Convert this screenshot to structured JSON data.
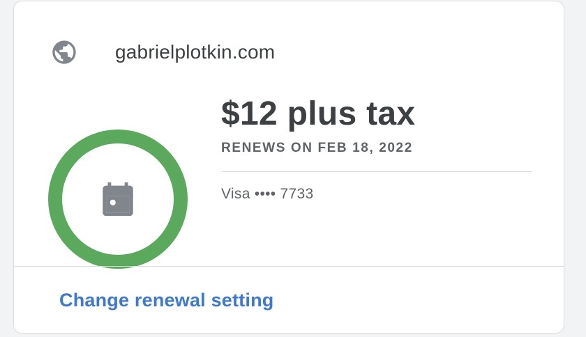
{
  "domain": {
    "name": "gabrielplotkin.com",
    "icon": "globe-icon"
  },
  "subscription": {
    "price": "$12 plus tax",
    "renews_label": "RENEWS ON FEB 18, 2022",
    "payment_method": "Visa •••• 7733",
    "status_icon": "calendar-icon",
    "ring_color": "#5aa95d"
  },
  "actions": {
    "change_renewal_label": "Change renewal setting",
    "link_color": "#3b78d8"
  }
}
